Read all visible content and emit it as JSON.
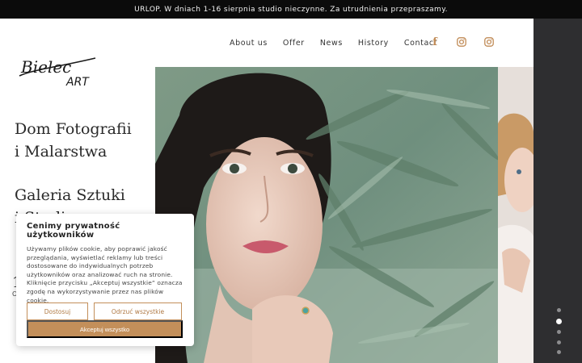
{
  "announcement": "URLOP. W dniach 1-16 sierpnia studio nieczynne. Za utrudnienia przepraszamy.",
  "nav": {
    "items": [
      "About us",
      "Offer",
      "News",
      "History",
      "Contact"
    ]
  },
  "social": [
    "facebook-icon",
    "instagram-icon",
    "instagram-icon"
  ],
  "logo": {
    "line1": "Bielec",
    "line2": "ART"
  },
  "taglines": {
    "first": "Dom Fotografii\ni Malarstwa",
    "second": "Galeria Sztuki\ni Studio"
  },
  "fragments": {
    "number": "1",
    "small": "O"
  },
  "cookie": {
    "title": "Cenimy prywatność użytkowników",
    "text": "Używamy plików cookie, aby poprawić jakość przeglądania, wyświetlać reklamy lub treści dostosowane do indywidualnych potrzeb użytkowników oraz analizować ruch na stronie. Kliknięcie przycisku „Akceptuj wszystkie” oznacza zgodę na wykorzystywanie przez nas plików cookie.",
    "customize_label": "Dostosuj",
    "reject_label": "Odrzuć wszystkie",
    "accept_label": "Akceptuj wszystko"
  },
  "slider": {
    "total": 5,
    "active_index": 1
  },
  "colors": {
    "accent": "#c38f5a",
    "topbar": "#0b0b0b",
    "strip": "#2e2e30"
  }
}
